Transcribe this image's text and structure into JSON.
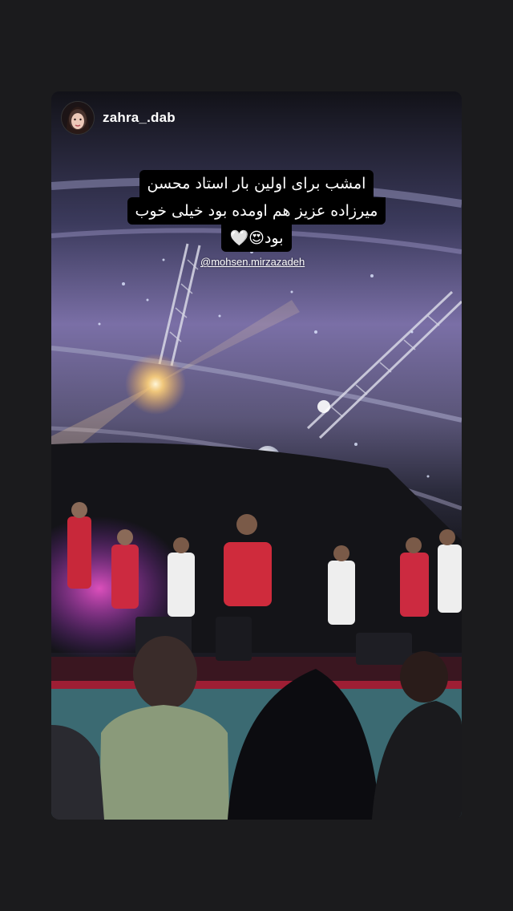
{
  "story": {
    "username": "zahra_.dab",
    "caption_lines": [
      "امشب برای اولین بار استاد محسن",
      "میرزاده عزیز هم اومده بود خیلی خوب",
      "بود😍🤍"
    ],
    "mention": "@mohsen.mirzazadeh"
  },
  "colors": {
    "page_background": "#1b1b1d",
    "caption_background": "#000000",
    "text": "#ffffff"
  },
  "icons": [
    "avatar-image",
    "story-photo"
  ]
}
